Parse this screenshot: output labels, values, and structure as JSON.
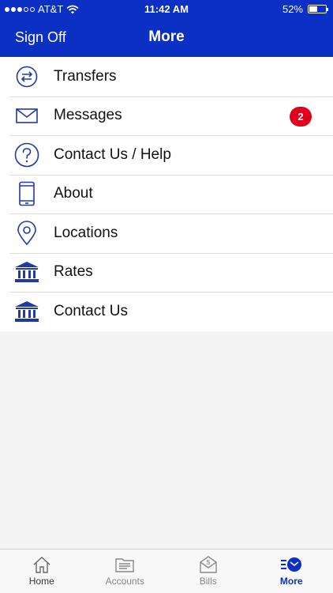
{
  "status": {
    "carrier": "AT&T",
    "time": "11:42 AM",
    "battery_text": "52%",
    "battery_level": 0.52
  },
  "header": {
    "left_action": "Sign Off",
    "title": "More"
  },
  "menu": {
    "items": [
      {
        "label": "Transfers",
        "icon": "transfer-arrows-icon"
      },
      {
        "label": "Messages",
        "icon": "envelope-icon",
        "badge": "2"
      },
      {
        "label": "Contact Us / Help",
        "icon": "question-circle-icon"
      },
      {
        "label": "About",
        "icon": "phone-device-icon"
      },
      {
        "label": "Locations",
        "icon": "map-pin-icon"
      },
      {
        "label": "Rates",
        "icon": "bank-building-icon"
      },
      {
        "label": "Contact Us",
        "icon": "bank-building-icon"
      }
    ]
  },
  "tabbar": {
    "tabs": [
      {
        "label": "Home",
        "icon": "home-icon"
      },
      {
        "label": "Accounts",
        "icon": "accounts-icon"
      },
      {
        "label": "Bills",
        "icon": "bills-icon"
      },
      {
        "label": "More",
        "icon": "more-icon",
        "active": true
      }
    ]
  },
  "colors": {
    "brand": "#0c2fc4",
    "icon": "#1f3aa8",
    "badge": "#e0001b"
  }
}
